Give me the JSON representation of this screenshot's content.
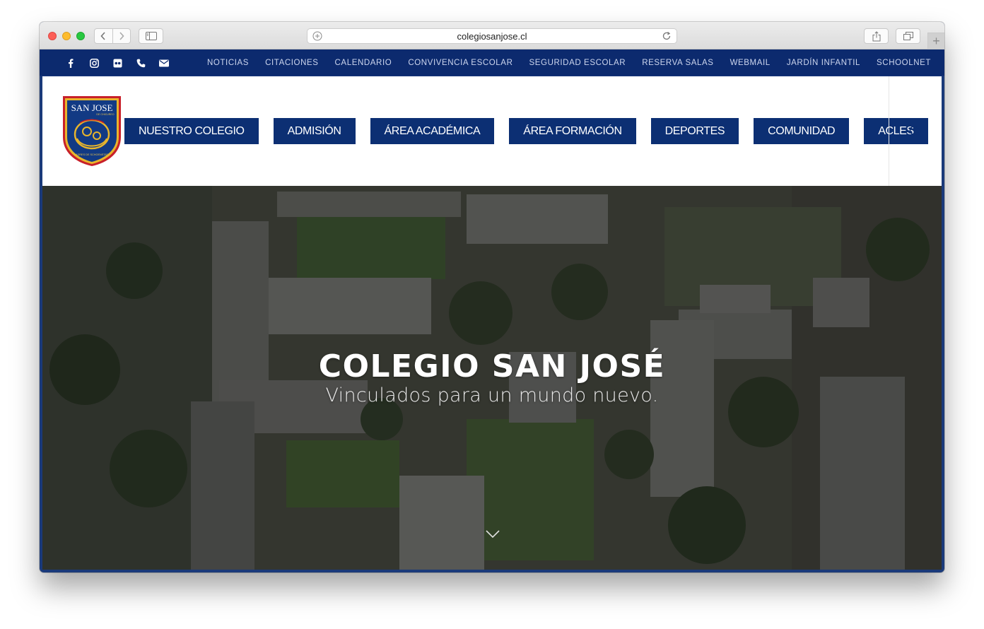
{
  "browser": {
    "url": "colegiosanjose.cl",
    "new_tab_symbol": "+"
  },
  "social_icons": [
    "facebook-icon",
    "instagram-icon",
    "flickr-icon",
    "phone-icon",
    "email-icon"
  ],
  "top_links": [
    "NOTICIAS",
    "CITACIONES",
    "CALENDARIO",
    "CONVIVENCIA ESCOLAR",
    "SEGURIDAD ESCOLAR",
    "RESERVA SALAS",
    "WEBMAIL",
    "JARDÍN INFANTIL",
    "SCHOOLNET"
  ],
  "logo": {
    "name": "SAN JOSE",
    "sub": "DE CHICUREO",
    "motto": "PADRES DE SCHOENSTATT"
  },
  "main_nav": [
    "NUESTRO COLEGIO",
    "ADMISIÓN",
    "ÁREA ACADÉMICA",
    "ÁREA FORMACIÓN",
    "DEPORTES",
    "COMUNIDAD",
    "ACLES"
  ],
  "hero": {
    "title": "COLEGIO SAN JOSÉ",
    "subtitle": "Vinculados para un mundo nuevo."
  },
  "colors": {
    "brand_blue": "#0c2f73",
    "topbar_blue": "#0c2a6e",
    "logo_red": "#c8202a",
    "logo_gold": "#d4a52a"
  }
}
